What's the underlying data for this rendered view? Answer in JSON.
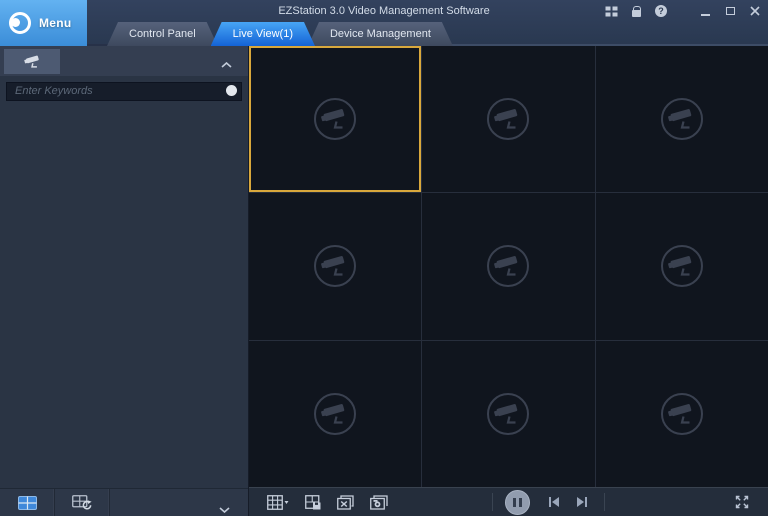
{
  "titlebar": {
    "title": "EZStation 3.0 Video Management Software",
    "menu_label": "Menu",
    "icons": [
      "screens-icon",
      "lock-icon",
      "help-icon",
      "minimize-icon",
      "maximize-icon",
      "close-icon"
    ]
  },
  "tabs": [
    {
      "label": "Control Panel",
      "active": false
    },
    {
      "label": "Live View(1)",
      "active": true
    },
    {
      "label": "Device Management",
      "active": false
    }
  ],
  "sidebar": {
    "panel_icon": "cctv-camera-icon",
    "collapse_icon": "chevron-up-icon",
    "search": {
      "placeholder": "Enter Keywords",
      "button_icon": "search-circle-icon"
    },
    "bottom_icons": [
      "view-layout-icon",
      "refresh-views-icon"
    ],
    "expand_icon": "chevron-down-icon"
  },
  "video_grid": {
    "rows": 3,
    "cols": 3,
    "tile_count": 9,
    "selected_index": 0,
    "placeholder_icon": "camera-placeholder-icon"
  },
  "toolbar": {
    "left_icons": [
      "screen-layout-icon",
      "save-view-icon",
      "close-all-icon",
      "snapshot-icon"
    ],
    "playback_icons": [
      "pause-button",
      "previous-button",
      "next-button"
    ],
    "right_icons": [
      "fullscreen-icon"
    ]
  },
  "colors": {
    "menu_button_blue": "#4da0e6",
    "active_tab_blue": "#1e6be0",
    "topbar_navy": "#2d3b54",
    "sidebar_bg": "#2a3444",
    "video_bg": "#10151e",
    "selected_tile_border": "#d9a83c"
  }
}
